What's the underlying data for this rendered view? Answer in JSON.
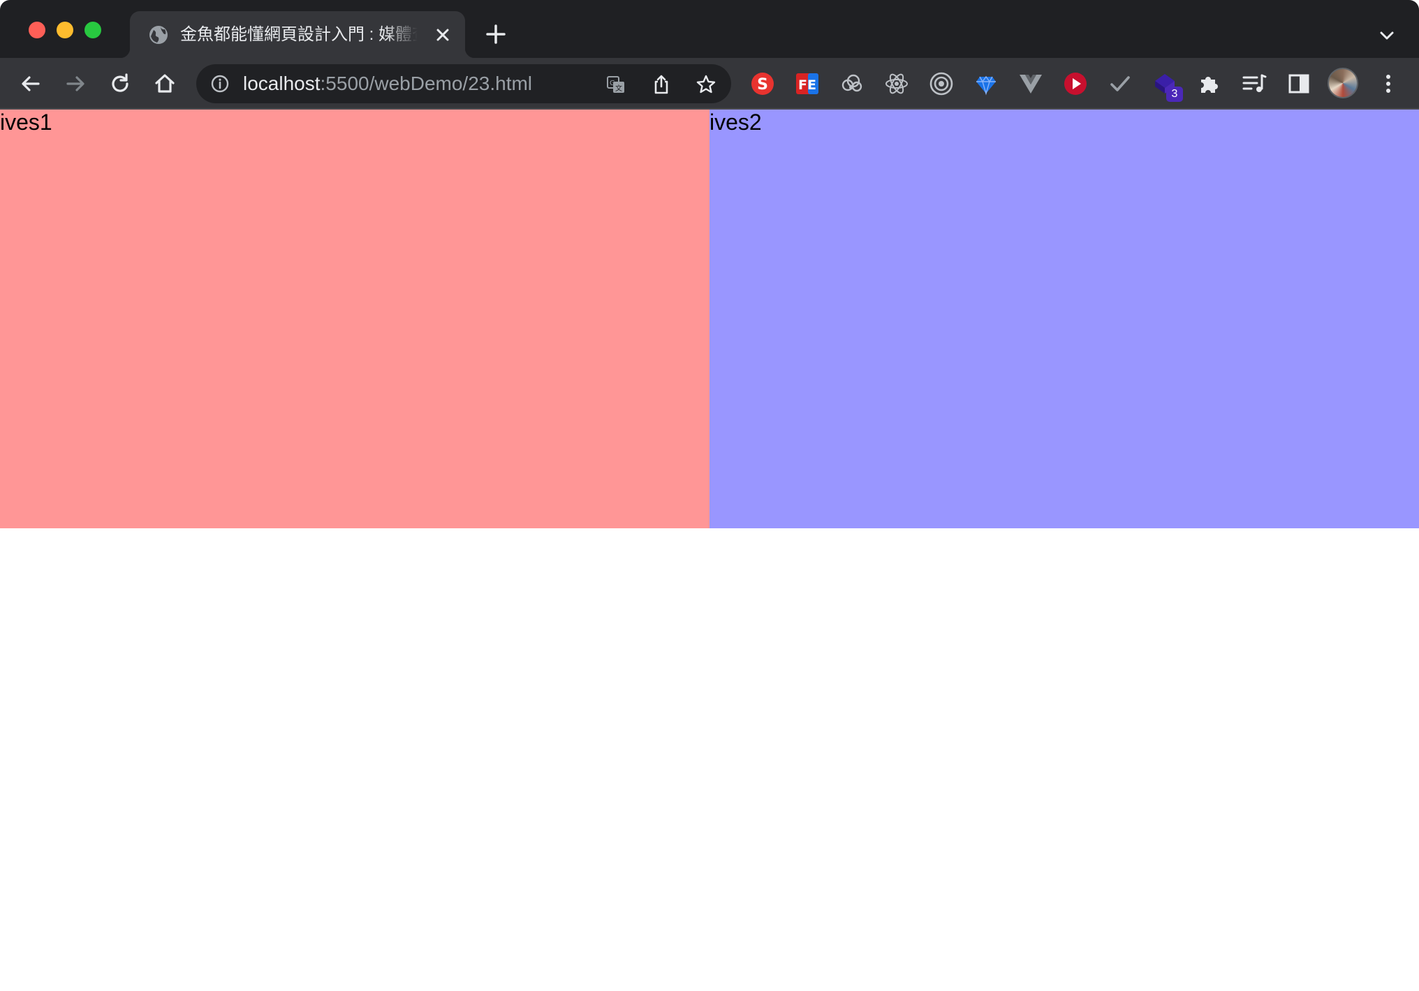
{
  "browser": {
    "tab": {
      "title": "金魚都能懂網頁設計入門 : 媒體查詢",
      "favicon": "globe-icon"
    },
    "address_bar": {
      "host": "localhost",
      "path": ":5500/webDemo/23.html"
    },
    "extensions": [
      {
        "name": "s-extension-icon",
        "color": "#e8332f"
      },
      {
        "name": "fe-extension-icon",
        "color": "#d92323"
      },
      {
        "name": "cloud-extension-icon",
        "color": "#bdc1c6"
      },
      {
        "name": "react-devtools-icon",
        "color": "#bdc1c6"
      },
      {
        "name": "target-extension-icon",
        "color": "#bdc1c6"
      },
      {
        "name": "gem-extension-icon",
        "color": "#1a73e8"
      },
      {
        "name": "vue-devtools-icon",
        "color": "#9aa0a6"
      },
      {
        "name": "play-extension-icon",
        "color": "#c8102e"
      },
      {
        "name": "check-extension-icon",
        "color": "#9aa0a6"
      },
      {
        "name": "cube-extension-icon",
        "color": "#3a1fa8"
      }
    ],
    "extension_badge": "3"
  },
  "page": {
    "box1": {
      "text": "ives1",
      "color": "#ff9696"
    },
    "box2": {
      "text": "ives2",
      "color": "#9996ff"
    }
  }
}
